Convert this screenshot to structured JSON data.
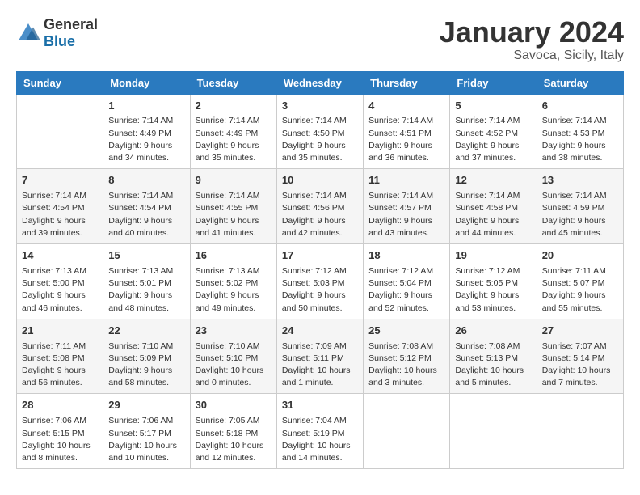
{
  "header": {
    "logo_general": "General",
    "logo_blue": "Blue",
    "month_title": "January 2024",
    "location": "Savoca, Sicily, Italy"
  },
  "weekdays": [
    "Sunday",
    "Monday",
    "Tuesday",
    "Wednesday",
    "Thursday",
    "Friday",
    "Saturday"
  ],
  "weeks": [
    [
      {
        "day": "",
        "sunrise": "",
        "sunset": "",
        "daylight": ""
      },
      {
        "day": "1",
        "sunrise": "Sunrise: 7:14 AM",
        "sunset": "Sunset: 4:49 PM",
        "daylight": "Daylight: 9 hours and 34 minutes."
      },
      {
        "day": "2",
        "sunrise": "Sunrise: 7:14 AM",
        "sunset": "Sunset: 4:49 PM",
        "daylight": "Daylight: 9 hours and 35 minutes."
      },
      {
        "day": "3",
        "sunrise": "Sunrise: 7:14 AM",
        "sunset": "Sunset: 4:50 PM",
        "daylight": "Daylight: 9 hours and 35 minutes."
      },
      {
        "day": "4",
        "sunrise": "Sunrise: 7:14 AM",
        "sunset": "Sunset: 4:51 PM",
        "daylight": "Daylight: 9 hours and 36 minutes."
      },
      {
        "day": "5",
        "sunrise": "Sunrise: 7:14 AM",
        "sunset": "Sunset: 4:52 PM",
        "daylight": "Daylight: 9 hours and 37 minutes."
      },
      {
        "day": "6",
        "sunrise": "Sunrise: 7:14 AM",
        "sunset": "Sunset: 4:53 PM",
        "daylight": "Daylight: 9 hours and 38 minutes."
      }
    ],
    [
      {
        "day": "7",
        "sunrise": "Sunrise: 7:14 AM",
        "sunset": "Sunset: 4:54 PM",
        "daylight": "Daylight: 9 hours and 39 minutes."
      },
      {
        "day": "8",
        "sunrise": "Sunrise: 7:14 AM",
        "sunset": "Sunset: 4:54 PM",
        "daylight": "Daylight: 9 hours and 40 minutes."
      },
      {
        "day": "9",
        "sunrise": "Sunrise: 7:14 AM",
        "sunset": "Sunset: 4:55 PM",
        "daylight": "Daylight: 9 hours and 41 minutes."
      },
      {
        "day": "10",
        "sunrise": "Sunrise: 7:14 AM",
        "sunset": "Sunset: 4:56 PM",
        "daylight": "Daylight: 9 hours and 42 minutes."
      },
      {
        "day": "11",
        "sunrise": "Sunrise: 7:14 AM",
        "sunset": "Sunset: 4:57 PM",
        "daylight": "Daylight: 9 hours and 43 minutes."
      },
      {
        "day": "12",
        "sunrise": "Sunrise: 7:14 AM",
        "sunset": "Sunset: 4:58 PM",
        "daylight": "Daylight: 9 hours and 44 minutes."
      },
      {
        "day": "13",
        "sunrise": "Sunrise: 7:14 AM",
        "sunset": "Sunset: 4:59 PM",
        "daylight": "Daylight: 9 hours and 45 minutes."
      }
    ],
    [
      {
        "day": "14",
        "sunrise": "Sunrise: 7:13 AM",
        "sunset": "Sunset: 5:00 PM",
        "daylight": "Daylight: 9 hours and 46 minutes."
      },
      {
        "day": "15",
        "sunrise": "Sunrise: 7:13 AM",
        "sunset": "Sunset: 5:01 PM",
        "daylight": "Daylight: 9 hours and 48 minutes."
      },
      {
        "day": "16",
        "sunrise": "Sunrise: 7:13 AM",
        "sunset": "Sunset: 5:02 PM",
        "daylight": "Daylight: 9 hours and 49 minutes."
      },
      {
        "day": "17",
        "sunrise": "Sunrise: 7:12 AM",
        "sunset": "Sunset: 5:03 PM",
        "daylight": "Daylight: 9 hours and 50 minutes."
      },
      {
        "day": "18",
        "sunrise": "Sunrise: 7:12 AM",
        "sunset": "Sunset: 5:04 PM",
        "daylight": "Daylight: 9 hours and 52 minutes."
      },
      {
        "day": "19",
        "sunrise": "Sunrise: 7:12 AM",
        "sunset": "Sunset: 5:05 PM",
        "daylight": "Daylight: 9 hours and 53 minutes."
      },
      {
        "day": "20",
        "sunrise": "Sunrise: 7:11 AM",
        "sunset": "Sunset: 5:07 PM",
        "daylight": "Daylight: 9 hours and 55 minutes."
      }
    ],
    [
      {
        "day": "21",
        "sunrise": "Sunrise: 7:11 AM",
        "sunset": "Sunset: 5:08 PM",
        "daylight": "Daylight: 9 hours and 56 minutes."
      },
      {
        "day": "22",
        "sunrise": "Sunrise: 7:10 AM",
        "sunset": "Sunset: 5:09 PM",
        "daylight": "Daylight: 9 hours and 58 minutes."
      },
      {
        "day": "23",
        "sunrise": "Sunrise: 7:10 AM",
        "sunset": "Sunset: 5:10 PM",
        "daylight": "Daylight: 10 hours and 0 minutes."
      },
      {
        "day": "24",
        "sunrise": "Sunrise: 7:09 AM",
        "sunset": "Sunset: 5:11 PM",
        "daylight": "Daylight: 10 hours and 1 minute."
      },
      {
        "day": "25",
        "sunrise": "Sunrise: 7:08 AM",
        "sunset": "Sunset: 5:12 PM",
        "daylight": "Daylight: 10 hours and 3 minutes."
      },
      {
        "day": "26",
        "sunrise": "Sunrise: 7:08 AM",
        "sunset": "Sunset: 5:13 PM",
        "daylight": "Daylight: 10 hours and 5 minutes."
      },
      {
        "day": "27",
        "sunrise": "Sunrise: 7:07 AM",
        "sunset": "Sunset: 5:14 PM",
        "daylight": "Daylight: 10 hours and 7 minutes."
      }
    ],
    [
      {
        "day": "28",
        "sunrise": "Sunrise: 7:06 AM",
        "sunset": "Sunset: 5:15 PM",
        "daylight": "Daylight: 10 hours and 8 minutes."
      },
      {
        "day": "29",
        "sunrise": "Sunrise: 7:06 AM",
        "sunset": "Sunset: 5:17 PM",
        "daylight": "Daylight: 10 hours and 10 minutes."
      },
      {
        "day": "30",
        "sunrise": "Sunrise: 7:05 AM",
        "sunset": "Sunset: 5:18 PM",
        "daylight": "Daylight: 10 hours and 12 minutes."
      },
      {
        "day": "31",
        "sunrise": "Sunrise: 7:04 AM",
        "sunset": "Sunset: 5:19 PM",
        "daylight": "Daylight: 10 hours and 14 minutes."
      },
      {
        "day": "",
        "sunrise": "",
        "sunset": "",
        "daylight": ""
      },
      {
        "day": "",
        "sunrise": "",
        "sunset": "",
        "daylight": ""
      },
      {
        "day": "",
        "sunrise": "",
        "sunset": "",
        "daylight": ""
      }
    ]
  ]
}
